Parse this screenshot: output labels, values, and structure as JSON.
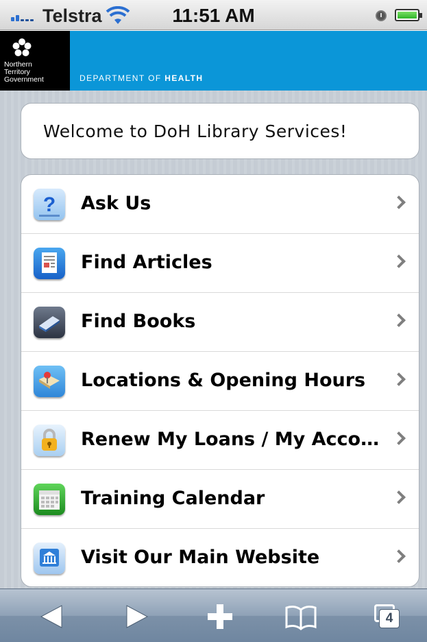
{
  "status_bar": {
    "carrier": "Telstra",
    "time": "11:51 AM"
  },
  "header": {
    "logo_lines": [
      "Northern",
      "Territory",
      "Government"
    ],
    "department_prefix": "DEPARTMENT OF",
    "department_name": "HEALTH"
  },
  "welcome_text": "Welcome to DoH Library Services!",
  "menu": [
    {
      "label": "Ask Us",
      "icon": "question-icon"
    },
    {
      "label": "Find Articles",
      "icon": "document-icon"
    },
    {
      "label": "Find Books",
      "icon": "book-icon"
    },
    {
      "label": "Locations & Opening Hours",
      "icon": "map-pin-icon"
    },
    {
      "label": "Renew My Loans / My Account",
      "icon": "padlock-icon"
    },
    {
      "label": "Training Calendar",
      "icon": "calendar-icon"
    },
    {
      "label": "Visit Our Main Website",
      "icon": "building-icon"
    }
  ],
  "toolbar": {
    "tab_count": "4"
  },
  "colors": {
    "header_blue": "#0b96d8",
    "background_stripes": "#c5ccd4"
  }
}
